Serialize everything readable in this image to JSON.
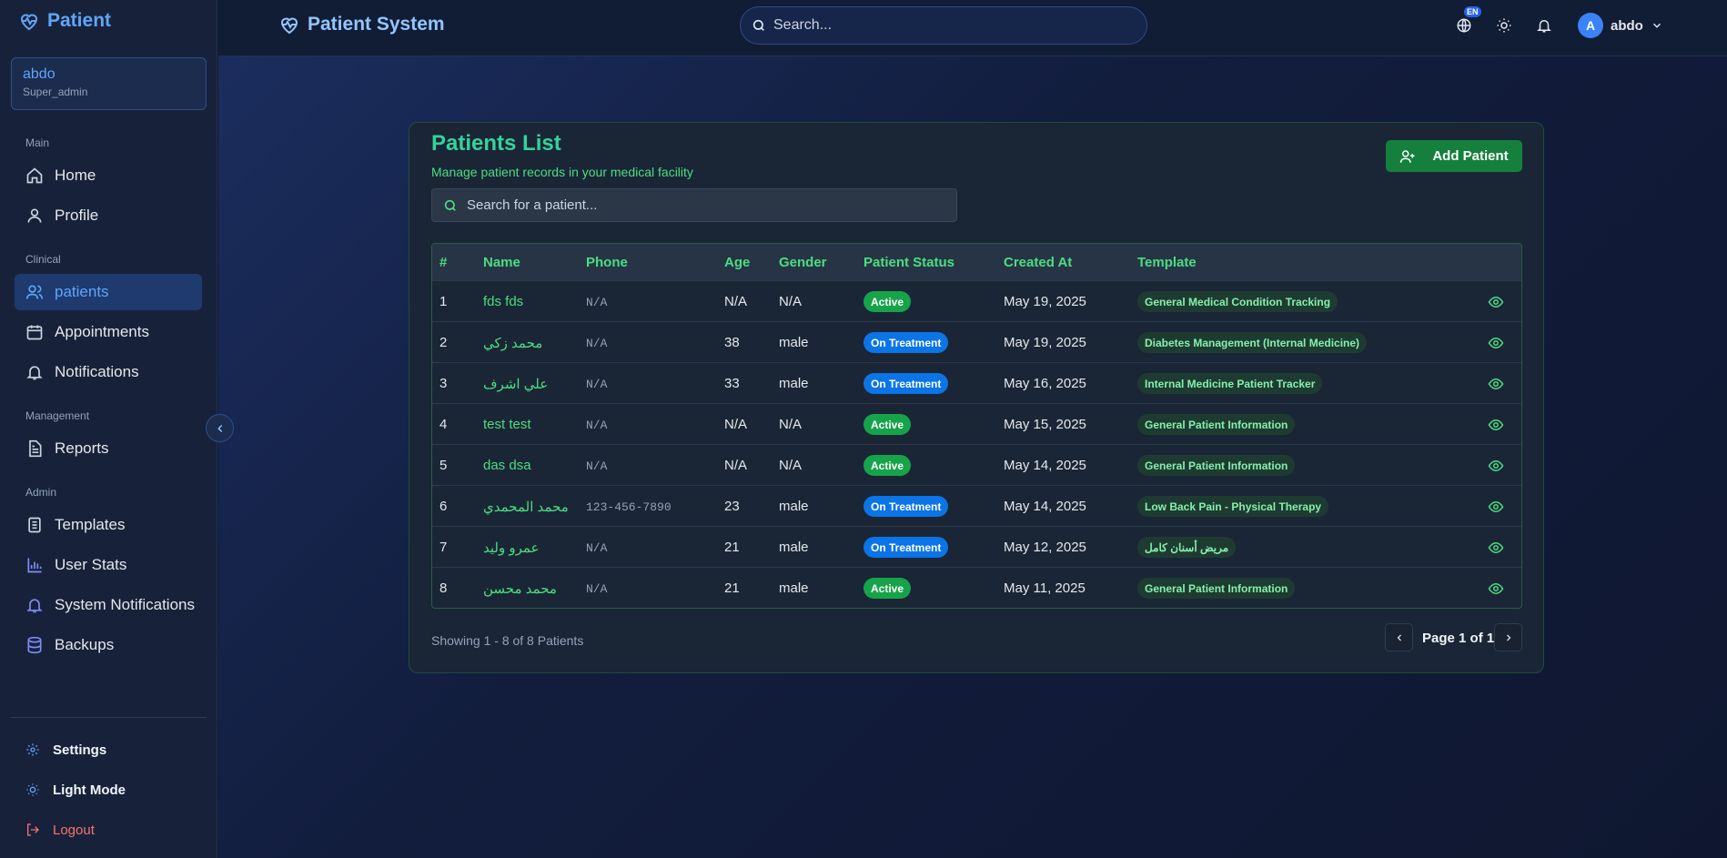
{
  "sidebar": {
    "logo_text": "Patient",
    "user": {
      "name": "abdo",
      "role": "Super_admin"
    },
    "sections": {
      "main": "Main",
      "clinical": "Clinical",
      "management": "Management",
      "admin": "Admin"
    },
    "items": {
      "home": "Home",
      "profile": "Profile",
      "patients": "patients",
      "appointments": "Appointments",
      "notifications": "Notifications",
      "reports": "Reports",
      "templates": "Templates",
      "user_stats": "User Stats",
      "system_notifications": "System Notifications",
      "backups": "Backups"
    },
    "bottom": {
      "settings": "Settings",
      "light_mode": "Light Mode",
      "logout": "Logout"
    }
  },
  "topbar": {
    "brand": "Patient System",
    "search_placeholder": "Search...",
    "language_badge": "EN",
    "user_initial": "A",
    "user_name": "abdo"
  },
  "page": {
    "title": "Patients List",
    "subtitle": "Manage patient records in your medical facility",
    "add_button": "Add Patient",
    "search_placeholder": "Search for a patient...",
    "columns": [
      "#",
      "Name",
      "Phone",
      "Age",
      "Gender",
      "Patient Status",
      "Created At",
      "Template"
    ],
    "rows": [
      {
        "num": "1",
        "name": "fds fds",
        "phone": "N/A",
        "age": "N/A",
        "gender": "N/A",
        "status": "Active",
        "created": "May 19, 2025",
        "template": "General Medical Condition Tracking"
      },
      {
        "num": "2",
        "name": "محمد زكي",
        "phone": "N/A",
        "age": "38",
        "gender": "male",
        "status": "On Treatment",
        "created": "May 19, 2025",
        "template": "Diabetes Management (Internal Medicine)"
      },
      {
        "num": "3",
        "name": "علي اشرف",
        "phone": "N/A",
        "age": "33",
        "gender": "male",
        "status": "On Treatment",
        "created": "May 16, 2025",
        "template": "Internal Medicine Patient Tracker"
      },
      {
        "num": "4",
        "name": "test test",
        "phone": "N/A",
        "age": "N/A",
        "gender": "N/A",
        "status": "Active",
        "created": "May 15, 2025",
        "template": "General Patient Information"
      },
      {
        "num": "5",
        "name": "das dsa",
        "phone": "N/A",
        "age": "N/A",
        "gender": "N/A",
        "status": "Active",
        "created": "May 14, 2025",
        "template": "General Patient Information"
      },
      {
        "num": "6",
        "name": "محمد المحمدي",
        "phone": "123-456-7890",
        "age": "23",
        "gender": "male",
        "status": "On Treatment",
        "created": "May 14, 2025",
        "template": "Low Back Pain - Physical Therapy"
      },
      {
        "num": "7",
        "name": "عمرو وليد",
        "phone": "N/A",
        "age": "21",
        "gender": "male",
        "status": "On Treatment",
        "created": "May 12, 2025",
        "template": "مريض أسنان كامل"
      },
      {
        "num": "8",
        "name": "محمد محسن",
        "phone": "N/A",
        "age": "21",
        "gender": "male",
        "status": "Active",
        "created": "May 11, 2025",
        "template": "General Patient Information"
      }
    ],
    "showing_text": "Showing 1 - 8 of 8 Patients",
    "page_label": "Page 1 of 1"
  },
  "colors": {
    "accent": "#60a5fa",
    "green": "#4ade80",
    "active_badge": "#16a34a",
    "treatment_badge": "#0b74e6",
    "logout": "#f87171"
  }
}
